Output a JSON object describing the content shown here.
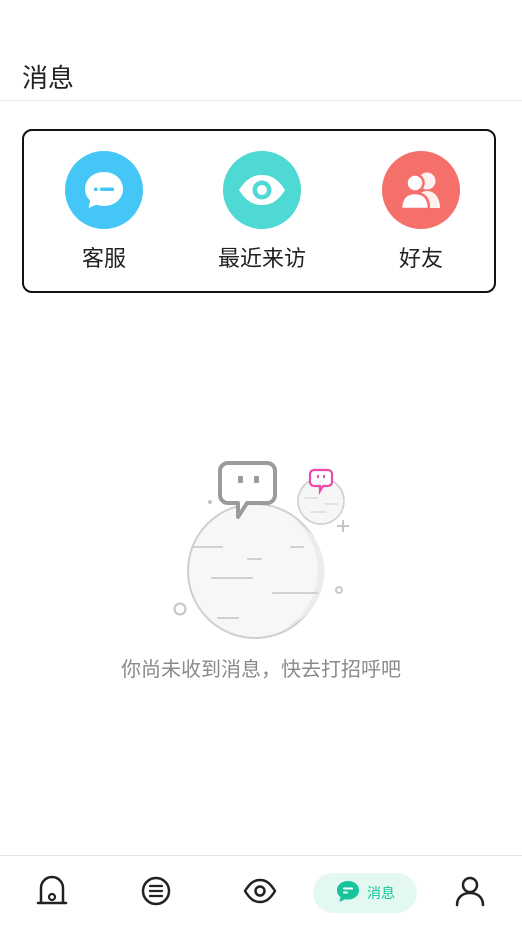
{
  "header": {
    "title": "消息"
  },
  "quick_actions": [
    {
      "label": "客服",
      "icon": "customer-service-chat-icon",
      "color": "#44c7f6"
    },
    {
      "label": "最近来访",
      "icon": "eye-icon",
      "color": "#4ed9d4"
    },
    {
      "label": "好友",
      "icon": "friends-icon",
      "color": "#f56f6b"
    }
  ],
  "empty_state": {
    "illustration": "planet-chat-bubble-illustration",
    "text": "你尚未收到消息，快去打招呼吧"
  },
  "bottom_nav": {
    "active_color": "#15c49a",
    "items": [
      {
        "icon": "home-icon",
        "label": ""
      },
      {
        "icon": "list-icon",
        "label": ""
      },
      {
        "icon": "eye-icon",
        "label": ""
      },
      {
        "icon": "message-icon",
        "label": "消息",
        "active": true
      },
      {
        "icon": "profile-icon",
        "label": ""
      }
    ]
  }
}
